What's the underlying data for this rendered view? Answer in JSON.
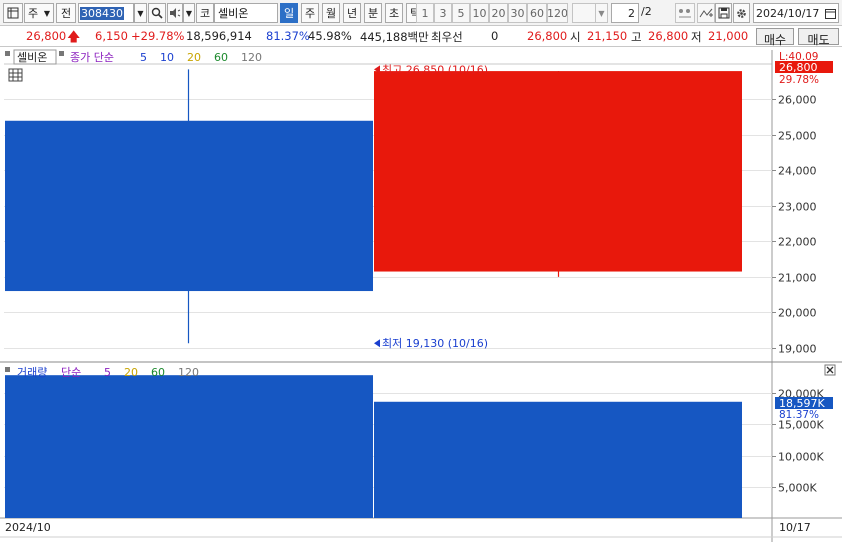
{
  "toolbar": {
    "period_type": "주",
    "prev_label": "전",
    "stock_code": "308430",
    "market_label": "코",
    "stock_name": "셀비온",
    "periods": [
      "일",
      "주",
      "월",
      "년",
      "분",
      "초",
      "틱"
    ],
    "selected_period": "일",
    "intervals": [
      "1",
      "3",
      "5",
      "10",
      "20",
      "30",
      "60",
      "120"
    ],
    "page_current": "2",
    "page_total": "/2",
    "date": "2024/10/17"
  },
  "quote": {
    "price": "26,800",
    "change": "6,150",
    "change_rate": "+29.78%",
    "volume": "18,596,914",
    "volume_ratio": "81.37%",
    "turnover": "45.98%",
    "amount": "445,188백만",
    "priority_label": "최우선",
    "priority_value": "0",
    "priority_price": "26,800",
    "open_label": "시",
    "open": "21,150",
    "high_label": "고",
    "high": "26,800",
    "low_label": "저",
    "low": "21,000",
    "buy_label": "매수",
    "sell_label": "매도"
  },
  "price_panel": {
    "name_tab": "셀비온",
    "legend_prefix": "종가 단순",
    "ma_periods": [
      {
        "label": "5",
        "color": "#1a3fcf"
      },
      {
        "label": "10",
        "color": "#1a3fcf"
      },
      {
        "label": "20",
        "color": "#c8a400"
      },
      {
        "label": "60",
        "color": "#1d8a2e"
      },
      {
        "label": "120",
        "color": "#777777"
      }
    ],
    "top_value": "L:40.09",
    "current_price_tag": "26,800",
    "current_rate_tag": "29.78%",
    "high_annotation": "최고 26,850 (10/16)",
    "low_annotation": "최저 19,130 (10/16)"
  },
  "volume_panel": {
    "legend_title": "거래량",
    "legend_prefix": "단순",
    "ma_periods": [
      {
        "label": "5",
        "color": "#8b1fbf"
      },
      {
        "label": "20",
        "color": "#c8a400"
      },
      {
        "label": "60",
        "color": "#1d8a2e"
      },
      {
        "label": "120",
        "color": "#777777"
      }
    ],
    "current_volume_tag": "18,597K",
    "current_ratio_tag": "81.37%"
  },
  "x_axis": {
    "start_label": "2024/10",
    "end_label": "10/17"
  },
  "colors": {
    "up": "#e8180c",
    "down": "#1657c2",
    "accent": "#2c6fc6"
  },
  "chart_data": [
    {
      "type": "candlestick",
      "title": "셀비온",
      "y_ticks": [
        19000,
        20000,
        21000,
        22000,
        23000,
        24000,
        25000,
        26000
      ],
      "y_tick_labels": [
        "19,000",
        "20,000",
        "21,000",
        "22,000",
        "23,000",
        "24,000",
        "25,000",
        "26,000"
      ],
      "ylim": [
        18600,
        27000
      ],
      "candles": [
        {
          "date": "10/16",
          "open": 25400,
          "high": 26850,
          "low": 19130,
          "close": 20600,
          "color": "down"
        },
        {
          "date": "10/17",
          "open": 21150,
          "high": 26800,
          "low": 21000,
          "close": 26800,
          "color": "up"
        }
      ]
    },
    {
      "type": "bar",
      "title": "거래량",
      "y_ticks": [
        5000,
        10000,
        15000,
        20000
      ],
      "y_tick_labels": [
        "5,000K",
        "10,000K",
        "15,000K",
        "20,000K"
      ],
      "ylim": [
        0,
        22400
      ],
      "categories": [
        "10/16",
        "10/17"
      ],
      "values": [
        22850,
        18597
      ],
      "colors": [
        "down",
        "down"
      ]
    }
  ]
}
